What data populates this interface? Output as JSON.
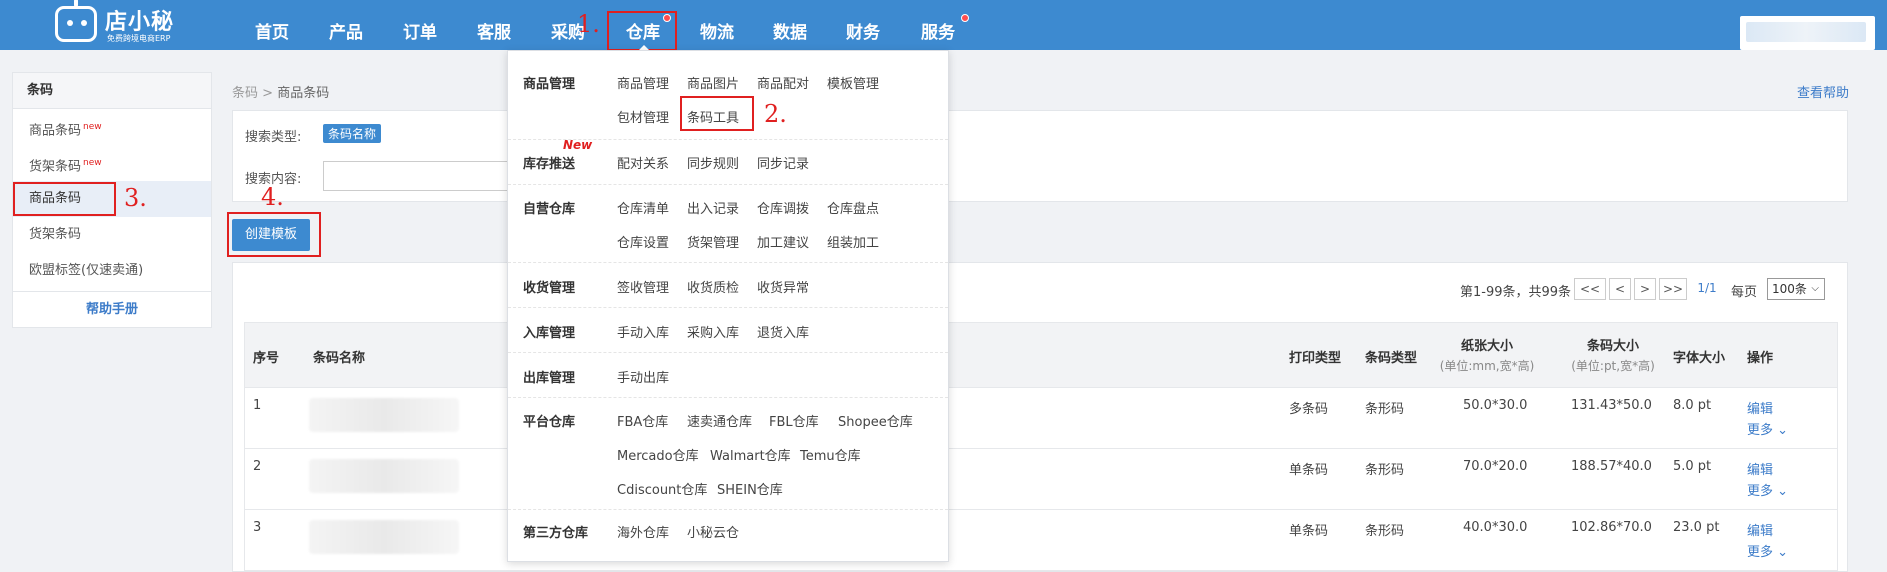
{
  "header": {
    "brand": "店小秘",
    "tagline": "免费跨境电商ERP",
    "nav": [
      "首页",
      "产品",
      "订单",
      "客服",
      "采购",
      "仓库",
      "物流",
      "数据",
      "财务",
      "服务"
    ]
  },
  "annotations": [
    "1.",
    "2.",
    "3.",
    "4."
  ],
  "sidebar": {
    "title": "条码",
    "items": [
      {
        "label": "商品条码",
        "badge": "new"
      },
      {
        "label": "货架条码",
        "badge": "new"
      },
      {
        "label": "商品条码",
        "badge": ""
      },
      {
        "label": "货架条码",
        "badge": ""
      },
      {
        "label": "欧盟标签(仅速卖通)",
        "badge": ""
      }
    ],
    "help": "帮助手册"
  },
  "breadcrumb": {
    "parent": "条码",
    "sep": ">",
    "current": "商品条码"
  },
  "help_link": "查看帮助",
  "search": {
    "type_label": "搜索类型:",
    "type_value": "条码名称",
    "content_label": "搜索内容:"
  },
  "create_button": "创建模板",
  "pager": {
    "summary": "第1-99条，共99条",
    "first": "<<",
    "prev": "<",
    "next": ">",
    "last": ">>",
    "page": "1/1",
    "per_page_label": "每页",
    "per_page": "100条"
  },
  "table": {
    "headers": {
      "index": "序号",
      "name": "条码名称",
      "print_type": "打印类型",
      "code_type": "条码类型",
      "paper_size": "纸张大小",
      "paper_unit": "(单位:mm,宽*高)",
      "code_size": "条码大小",
      "code_unit": "(单位:pt,宽*高)",
      "font_size": "字体大小",
      "action": "操作"
    },
    "rows": [
      {
        "index": "1",
        "print_type": "多条码",
        "code_type": "条形码",
        "paper_size": "50.0*30.0",
        "code_size": "131.43*50.0",
        "font_size": "8.0 pt",
        "edit": "编辑",
        "more": "更多"
      },
      {
        "index": "2",
        "print_type": "单条码",
        "code_type": "条形码",
        "paper_size": "70.0*20.0",
        "code_size": "188.57*40.0",
        "font_size": "5.0 pt",
        "edit": "编辑",
        "more": "更多"
      },
      {
        "index": "3",
        "print_type": "单条码",
        "code_type": "条形码",
        "paper_size": "40.0*30.0",
        "code_size": "102.86*70.0",
        "font_size": "23.0 pt",
        "edit": "编辑",
        "more": "更多"
      }
    ]
  },
  "dropdown": {
    "new_badge": "New",
    "groups": [
      {
        "title": "商品管理",
        "links": [
          "商品管理",
          "商品图片",
          "商品配对",
          "模板管理",
          "包材管理",
          "条码工具"
        ]
      },
      {
        "title": "库存推送",
        "links": [
          "配对关系",
          "同步规则",
          "同步记录"
        ]
      },
      {
        "title": "自营仓库",
        "links": [
          "仓库清单",
          "出入记录",
          "仓库调拨",
          "仓库盘点",
          "仓库设置",
          "货架管理",
          "加工建议",
          "组装加工"
        ]
      },
      {
        "title": "收货管理",
        "links": [
          "签收管理",
          "收货质检",
          "收货异常"
        ]
      },
      {
        "title": "入库管理",
        "links": [
          "手动入库",
          "采购入库",
          "退货入库"
        ]
      },
      {
        "title": "出库管理",
        "links": [
          "手动出库"
        ]
      },
      {
        "title": "平台仓库",
        "links": [
          "FBA仓库",
          "速卖通仓库",
          "FBL仓库",
          "Shopee仓库",
          "Mercado仓库",
          "Walmart仓库",
          "Temu仓库",
          "Cdiscount仓库",
          "SHEIN仓库"
        ]
      },
      {
        "title": "第三方仓库",
        "links": [
          "海外仓库",
          "小秘云仓"
        ]
      }
    ]
  },
  "colors": {
    "primary": "#3d8ad0",
    "annotation": "#e02020",
    "link": "#3d7cc9"
  }
}
